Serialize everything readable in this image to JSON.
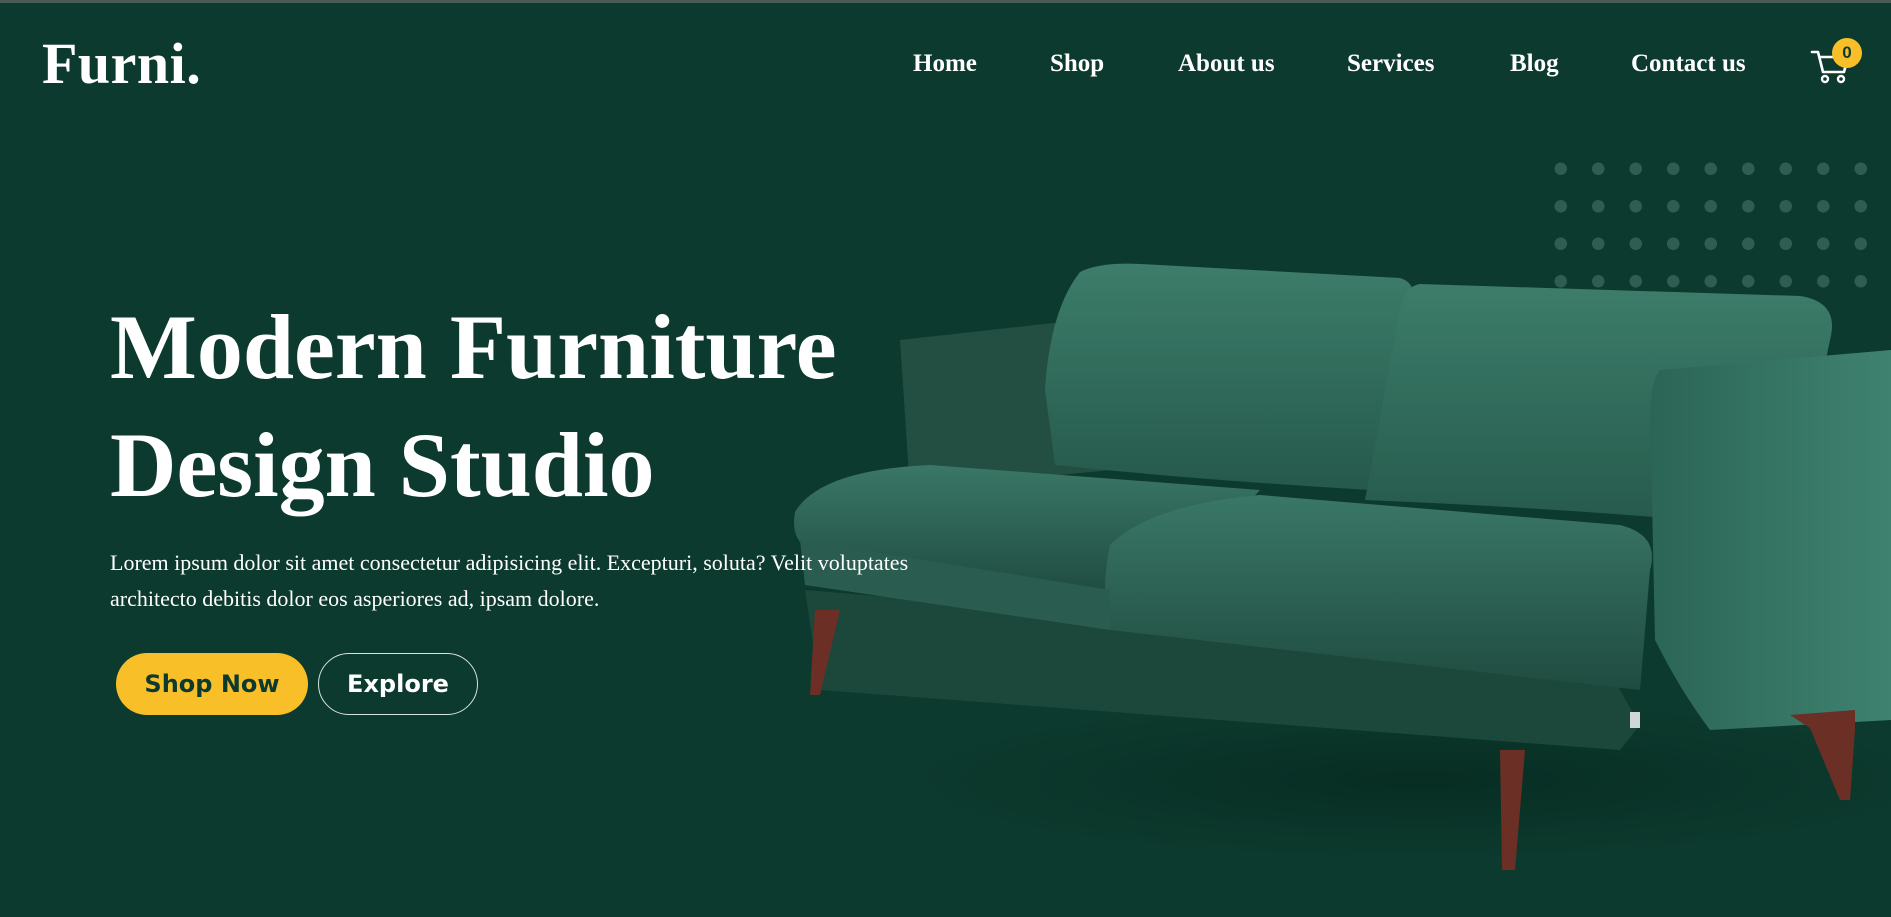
{
  "brand": {
    "logo": "Furni."
  },
  "nav": {
    "items": [
      {
        "label": "Home"
      },
      {
        "label": "Shop"
      },
      {
        "label": "About us"
      },
      {
        "label": "Services"
      },
      {
        "label": "Blog"
      },
      {
        "label": "Contact us"
      }
    ],
    "cart": {
      "icon": "cart-icon",
      "count": "0"
    }
  },
  "hero": {
    "title_line1": "Modern Furniture",
    "title_line2": "Design Studio",
    "text_line1": "Lorem ipsum dolor sit amet consectetur adipisicing elit. Excepturi, soluta? Velit voluptates",
    "text_line2": "architecto debitis dolor eos asperiores ad, ipsam dolore.",
    "primary_button": "Shop Now",
    "secondary_button": "Explore",
    "image": "green-velvet-sofa"
  },
  "colors": {
    "background": "#0d3a2e",
    "accent": "#f9bf29",
    "text": "#ffffff",
    "sofa": "#2f6b5a"
  }
}
